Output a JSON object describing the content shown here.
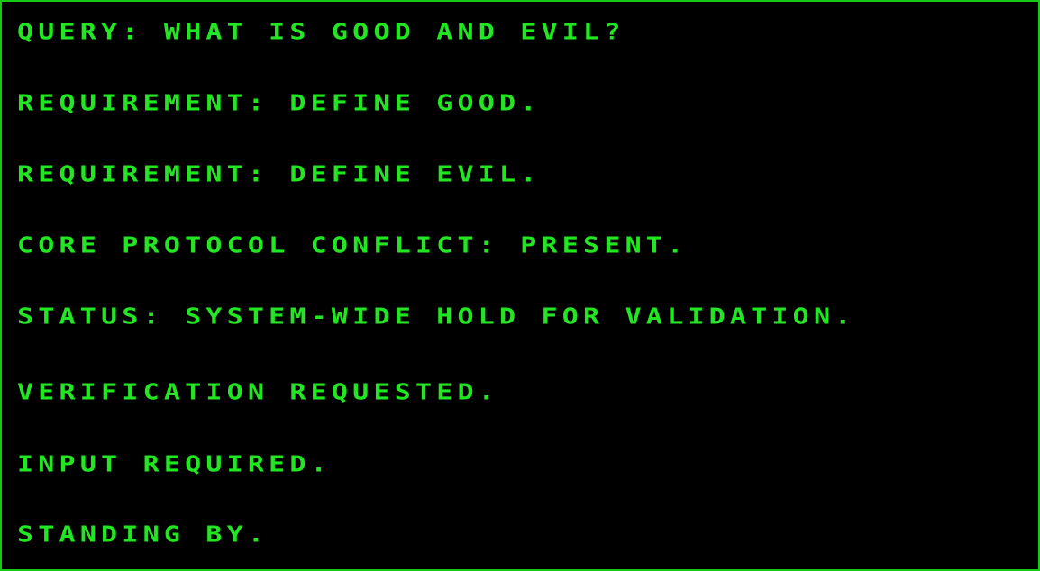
{
  "colors": {
    "background": "#000000",
    "text": "#22e622",
    "border": "#15c915"
  },
  "terminal": {
    "lines": [
      "QUERY: WHAT IS GOOD AND EVIL?",
      "REQUIREMENT: DEFINE GOOD.",
      "REQUIREMENT: DEFINE EVIL.",
      "CORE PROTOCOL CONFLICT: PRESENT.",
      "STATUS: SYSTEM-WIDE HOLD FOR VALIDATION.",
      "VERIFICATION REQUESTED.",
      "INPUT REQUIRED.",
      "STANDING BY."
    ]
  }
}
